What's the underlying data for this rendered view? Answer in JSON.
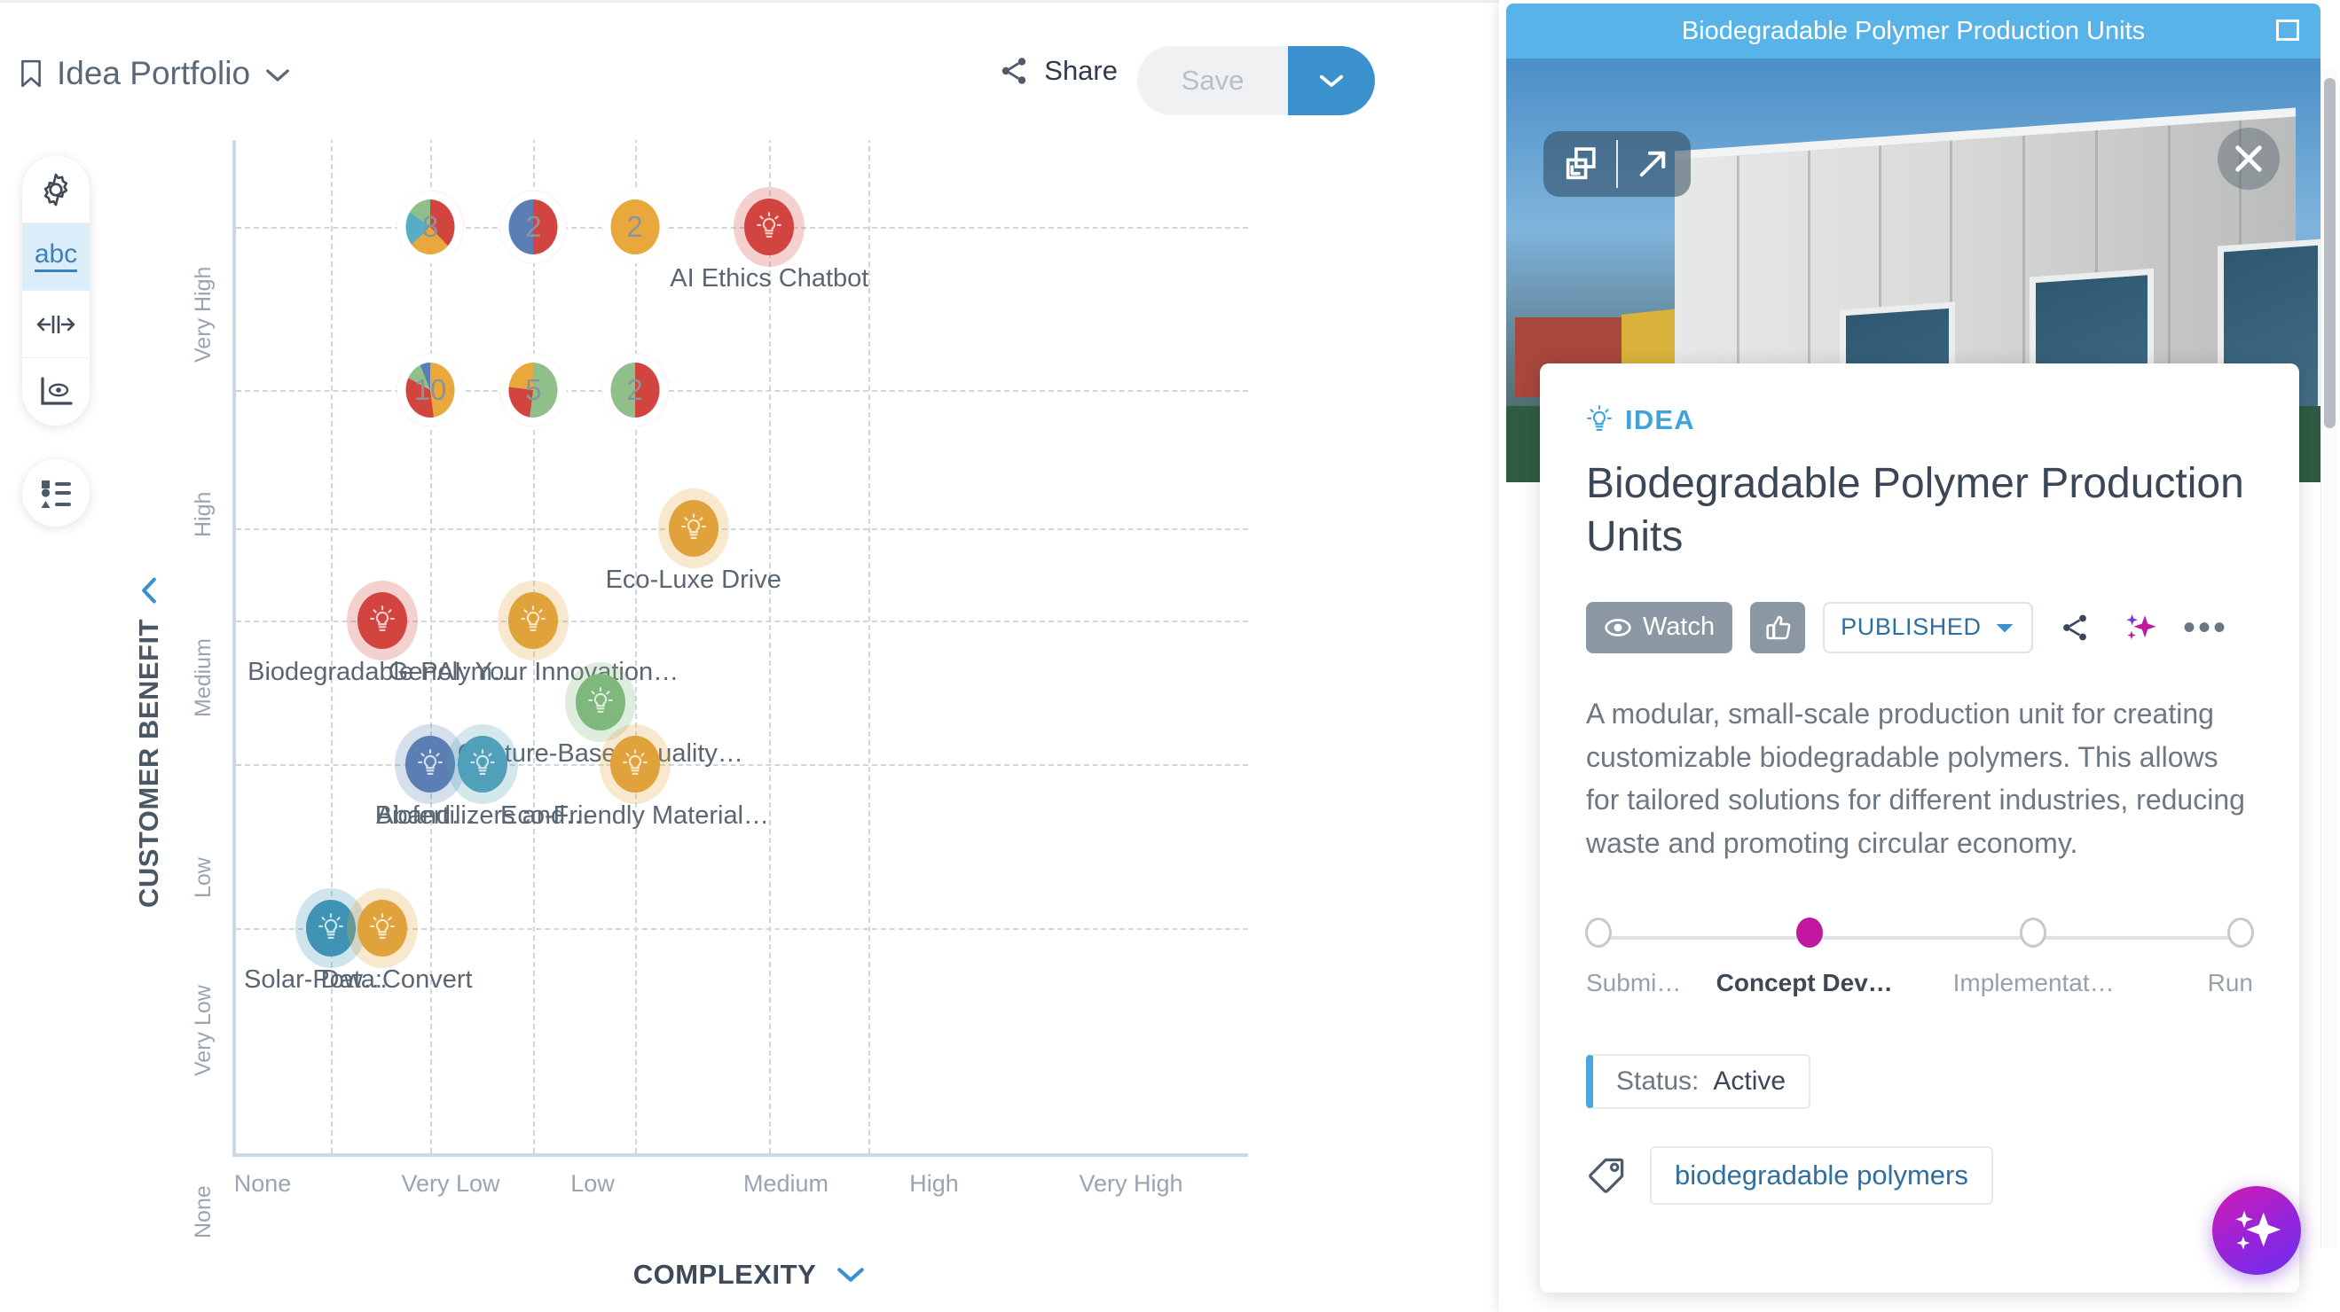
{
  "header": {
    "portfolio_icon": "bookmark-icon",
    "portfolio_title": "Idea Portfolio",
    "share_label": "Share",
    "save_label": "Save"
  },
  "left_toolbar": {
    "items": [
      {
        "icon": "gear-icon",
        "name": "settings",
        "active": false
      },
      {
        "icon": "abc-icon",
        "name": "labels",
        "active": true,
        "label": "abc"
      },
      {
        "icon": "axis-width-icon",
        "name": "axis-range",
        "active": false
      },
      {
        "icon": "axis-visibility-icon",
        "name": "axis-visibility",
        "active": false
      }
    ],
    "legend_button": {
      "icon": "legend-list-icon",
      "name": "legend"
    }
  },
  "chart_data": {
    "type": "scatter",
    "title": "",
    "xlabel": "COMPLEXITY",
    "ylabel": "CUSTOMER BENEFIT",
    "x_ticks": [
      "None",
      "Very Low",
      "Low",
      "Medium",
      "High",
      "Very High"
    ],
    "y_ticks": [
      "None",
      "Very Low",
      "Low",
      "Medium",
      "High",
      "Very High"
    ],
    "grid": true,
    "legend_position": "hidden",
    "clusters": [
      {
        "label": "8",
        "x": "Low",
        "y": "Very High",
        "xp": 19.2,
        "yp": 9.6,
        "segments": [
          {
            "color": "#d2453f",
            "pct": 38
          },
          {
            "color": "#e8a83c",
            "pct": 25
          },
          {
            "color": "#57aec4",
            "pct": 22
          },
          {
            "color": "#8fc08a",
            "pct": 15
          }
        ]
      },
      {
        "label": "2",
        "x": "Low-Medium",
        "y": "Very High",
        "xp": 29.4,
        "yp": 9.6,
        "segments": [
          {
            "color": "#d2453f",
            "pct": 50
          },
          {
            "color": "#5b7fb4",
            "pct": 50
          }
        ]
      },
      {
        "label": "2",
        "x": "Medium-High",
        "y": "Very High",
        "xp": 39.4,
        "yp": 9.6,
        "segments": [
          {
            "color": "#e8a83c",
            "pct": 100
          }
        ]
      },
      {
        "label": "10",
        "x": "Low",
        "y": "High",
        "xp": 19.2,
        "yp": 25.5,
        "segments": [
          {
            "color": "#e8a83c",
            "pct": 48
          },
          {
            "color": "#d2453f",
            "pct": 35
          },
          {
            "color": "#8fc08a",
            "pct": 11
          },
          {
            "color": "#5b7fb4",
            "pct": 6
          }
        ]
      },
      {
        "label": "5",
        "x": "Medium",
        "y": "High",
        "xp": 29.4,
        "yp": 25.5,
        "segments": [
          {
            "color": "#8fc08a",
            "pct": 52
          },
          {
            "color": "#d2453f",
            "pct": 25
          },
          {
            "color": "#e8a83c",
            "pct": 23
          }
        ]
      },
      {
        "label": "2",
        "x": "High",
        "y": "High",
        "xp": 39.4,
        "yp": 25.5,
        "segments": [
          {
            "color": "#d2453f",
            "pct": 50
          },
          {
            "color": "#8fc08a",
            "pct": 50
          }
        ]
      }
    ],
    "ideas": [
      {
        "label": "AI Ethics Chatbot",
        "color": "#d2453f",
        "xp": 52.7,
        "yp": 9.6
      },
      {
        "label": "Eco-Luxe Drive",
        "color": "#e0a23a",
        "xp": 45.2,
        "yp": 39.0
      },
      {
        "label": "Biodegradable Polym…",
        "color": "#d2453f",
        "xp": 14.5,
        "yp": 48.0
      },
      {
        "label": "GenAI: Your Innovation…",
        "color": "#e0a23a",
        "xp": 29.4,
        "yp": 48.0
      },
      {
        "label": "Gesture-Based Quality…",
        "color": "#7fb87c",
        "xp": 36.0,
        "yp": 56.0
      },
      {
        "label": "Aband…",
        "color": "#5b7fb4",
        "xp": 19.2,
        "yp": 62.0
      },
      {
        "label": "Biofertilizers and…",
        "color": "#4fa0b8",
        "xp": 24.4,
        "yp": 62.0
      },
      {
        "label": "Eco-Friendly Material…",
        "color": "#e0a23a",
        "xp": 39.4,
        "yp": 62.0
      },
      {
        "label": "Solar-Pow…",
        "color": "#3f95b5",
        "xp": 9.4,
        "yp": 78.0
      },
      {
        "label": "Data:Convert",
        "color": "#e0a23a",
        "xp": 14.5,
        "yp": 78.0
      }
    ]
  },
  "panel": {
    "window_title": "Biodegradable Polymer Production Units",
    "minimize_icon": "minimize-icon",
    "hero": {
      "restore_icon": "restore-window-icon",
      "open_icon": "open-external-icon",
      "close_icon": "close-icon"
    },
    "kicker_icon": "lightbulb-icon",
    "kicker": "IDEA",
    "title": "Biodegradable Polymer Production Units",
    "actions": {
      "watch_label": "Watch",
      "watch_icon": "eye-icon",
      "like_icon": "thumbs-up-icon",
      "status_select": "PUBLISHED",
      "share_icon": "share-icon",
      "ai_icon": "sparkle-icon",
      "more_icon": "more-dots-icon"
    },
    "description": "A modular, small-scale production unit for creating customizable biodegradable polymers. This allows for tailored solutions for different industries, reducing waste and promoting circular economy.",
    "stages": [
      {
        "label": "Submi…",
        "current": false
      },
      {
        "label": "Concept Dev…",
        "current": true
      },
      {
        "label": "Implementat…",
        "current": false
      },
      {
        "label": "Run",
        "current": false
      }
    ],
    "stage_accent": "#c2189f",
    "status": {
      "key": "Status:",
      "value": "Active",
      "accent": "#4aa8e0"
    },
    "tag_icon": "tag-icon",
    "tags": [
      "biodegradable polymers"
    ]
  },
  "ai_fab": {
    "icon": "sparkle-icon",
    "name": "ai-assistant"
  },
  "colors": {
    "accent_blue": "#3b91cd",
    "panel_header": "#58b4e8",
    "stage_pink": "#c2189f"
  }
}
